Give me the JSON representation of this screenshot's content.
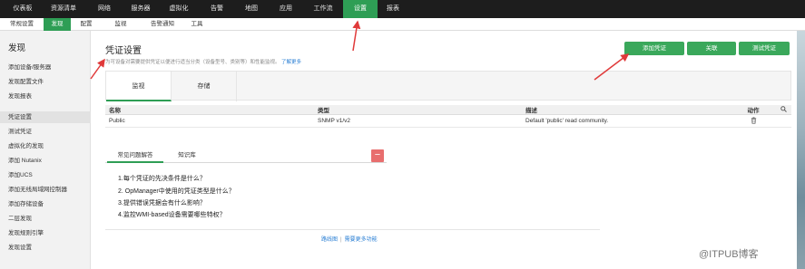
{
  "topnav": {
    "items": [
      "仪表板",
      "资源清单",
      "网络",
      "服务器",
      "虚拟化",
      "告警",
      "地图",
      "应用",
      "工作流",
      "设置",
      "报表"
    ],
    "active": "设置"
  },
  "subnav": {
    "items": [
      "常规设置",
      "发现",
      "配置",
      "监视",
      "告警通知",
      "工具"
    ],
    "active": "发现"
  },
  "sidebar": {
    "title": "发现",
    "items": [
      "添加设备/服务器",
      "发现配置文件",
      "发现报表",
      "凭证设置",
      "测试凭证",
      "虚拟化的发现",
      "添加 Nutanix",
      "添加UCS",
      "添加无线局域网控制器",
      "添加存储设备",
      "二层发现",
      "发现规则引擎",
      "发现设置"
    ],
    "active": "凭证设置"
  },
  "page": {
    "title": "凭证设置",
    "description": "为可设备对需要提供凭证以便进行适当分类（设备型号、类别等）和性能监视。",
    "learn_more": "了解更多"
  },
  "buttons": {
    "add": "添加凭证",
    "associate": "关联",
    "test": "测试凭证"
  },
  "tabs": [
    "监视",
    "存储"
  ],
  "table": {
    "headers": [
      "名称",
      "类型",
      "描述",
      "动作"
    ],
    "rows": [
      {
        "name": "Public",
        "type": "SNMP v1/v2",
        "description": "Default 'public' read community."
      }
    ]
  },
  "faq": {
    "tabs": [
      "常见问题解答",
      "知识库"
    ],
    "items": [
      "1.每个凭证的先决条件是什么？",
      "2. OpManager中使用的凭证类型是什么？",
      "3.提供错误凭据会有什么影响？",
      "4.监控WMI-based设备需要哪些特权？"
    ],
    "links": [
      "路线图",
      "需要更多功能"
    ]
  },
  "watermark": "@ITPUB博客",
  "colors": {
    "accent": "#2e9e55",
    "arrow": "#e03a3a",
    "collapse": "#e86e6e"
  }
}
